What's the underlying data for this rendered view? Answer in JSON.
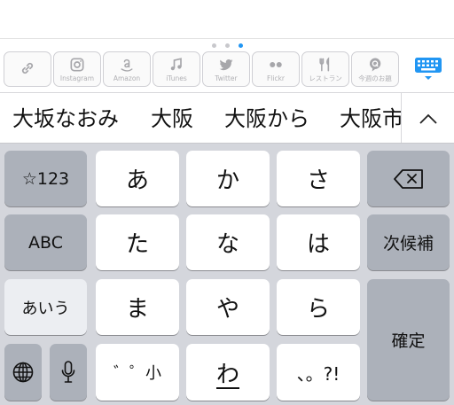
{
  "extensions": [
    {
      "name": "link-icon",
      "label": ""
    },
    {
      "name": "instagram-icon",
      "label": "Instagram"
    },
    {
      "name": "amazon-icon",
      "label": "Amazon"
    },
    {
      "name": "music-note-icon",
      "label": "iTunes"
    },
    {
      "name": "twitter-bird-icon",
      "label": "Twitter"
    },
    {
      "name": "flickr-dots-icon",
      "label": "Flickr"
    },
    {
      "name": "restaurant-icon",
      "label": "レストラン"
    },
    {
      "name": "q-badge-icon",
      "label": "今週のお題"
    }
  ],
  "candidates": [
    "大坂なおみ",
    "大阪",
    "大阪から",
    "大阪市"
  ],
  "keys": {
    "num": "☆123",
    "a": "あ",
    "ka": "か",
    "sa": "さ",
    "abc": "ABC",
    "ta": "た",
    "na": "な",
    "ha": "は",
    "next": "次候補",
    "kana": "あいう",
    "ma": "ま",
    "ya": "や",
    "ra": "ら",
    "confirm": "確定",
    "small": "゛゜小",
    "wa": "わ",
    "punct": "、。?!"
  },
  "colors": {
    "accent": "#2196f3",
    "keyboard_bg": "#d4d6dc",
    "dark_key": "#acb1ba"
  }
}
